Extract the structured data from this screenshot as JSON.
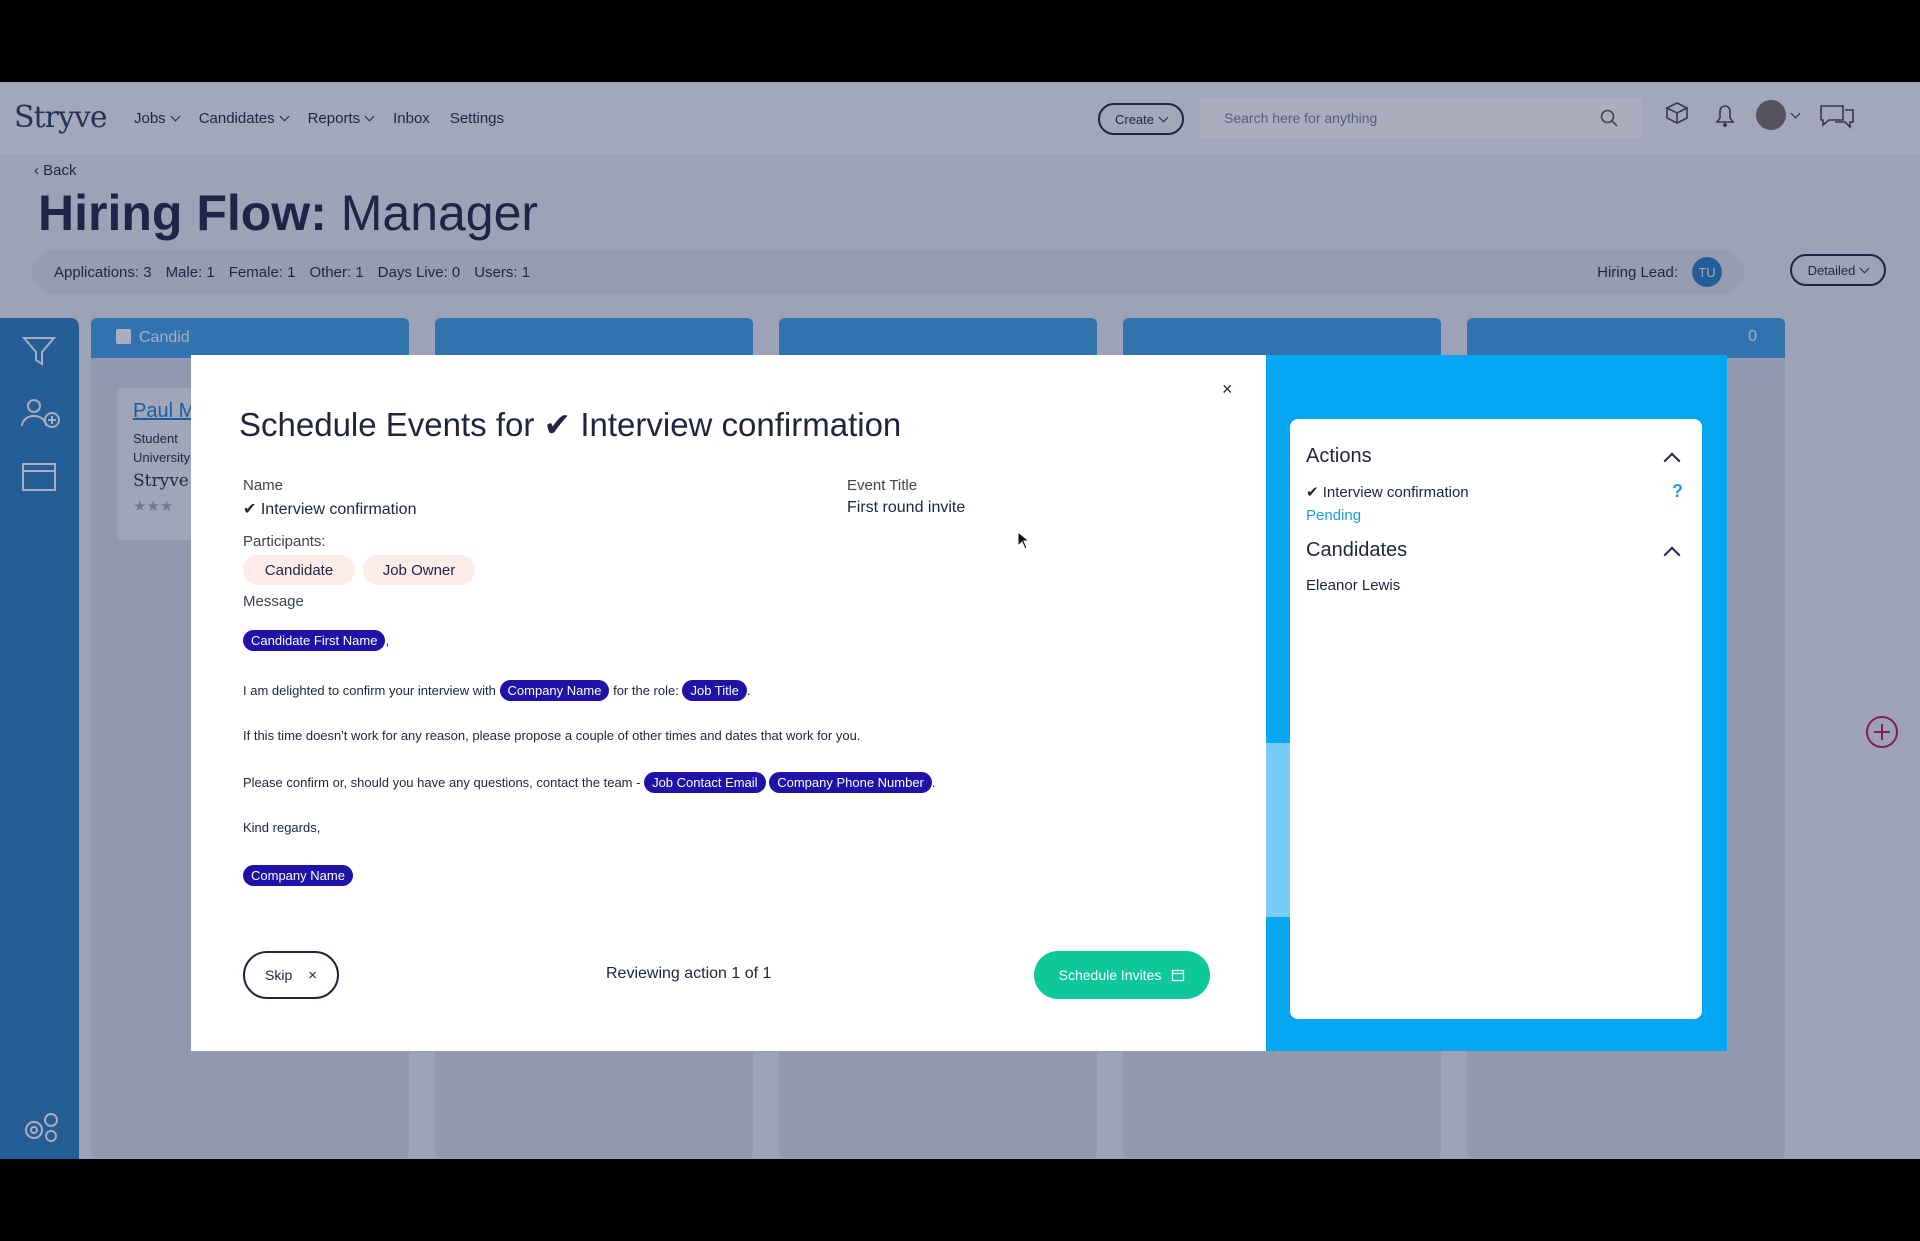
{
  "nav": {
    "logo": "Stryve",
    "items": [
      "Jobs",
      "Candidates",
      "Reports",
      "Inbox",
      "Settings"
    ],
    "create_label": "Create",
    "search_placeholder": "Search here for anything"
  },
  "page": {
    "back_label": "Back",
    "title_bold": "Hiring Flow:",
    "title_rest": " Manager",
    "stats": [
      "Applications: 3",
      "Male: 1",
      "Female: 1",
      "Other: 1",
      "Days Live: 0",
      "Users: 1"
    ],
    "hiring_lead_label": "Hiring Lead:",
    "hiring_lead_initials": "TU",
    "view_mode": "Detailed"
  },
  "board": {
    "first_column_header": "Candid",
    "last_column_count": "0",
    "card": {
      "name": "Paul M",
      "line1": "Student",
      "line2": "University",
      "logo": "Stryve"
    }
  },
  "modal": {
    "close_icon": "×",
    "title": "Schedule Events for ✔ Interview confirmation",
    "name_label": "Name",
    "name_value": "✔ Interview confirmation",
    "event_title_label": "Event Title",
    "event_title_value": "First round invite",
    "participants_label": "Participants:",
    "participants": [
      "Candidate",
      "Job Owner"
    ],
    "message_label": "Message",
    "message": {
      "line1_tag": "Candidate First Name",
      "line1_suffix": ",",
      "line2_text": "I am delighted to confirm your interview with",
      "line2_tag1": "Company Name",
      "line2_mid": "for the role:",
      "line2_tag2": "Job Title",
      "line2_suffix": ".",
      "line3_text": "If this time doesn't work for any reason, please propose a couple of other times and dates that work for you.",
      "line4_text": "Please confirm or, should you have any questions, contact the team -",
      "line4_tag1": "Job Contact Email",
      "line4_tag2": "Company Phone Number",
      "line4_suffix": ".",
      "line5_text": "Kind regards,",
      "line6_tag": "Company Name"
    },
    "skip_label": "Skip",
    "reviewing_text": "Reviewing action 1 of 1",
    "schedule_label": "Schedule Invites"
  },
  "side_panel": {
    "actions_title": "Actions",
    "action_item": "✔ Interview confirmation",
    "action_help": "?",
    "action_status": "Pending",
    "candidates_title": "Candidates",
    "candidate_name": "Eleanor Lewis"
  },
  "colors": {
    "accent_blue": "#05a6f2",
    "tag_navy": "#1e12a8",
    "schedule_green": "#0cc89a",
    "pending_blue": "#1a9ee0",
    "chip_pink": "#fdecea"
  }
}
